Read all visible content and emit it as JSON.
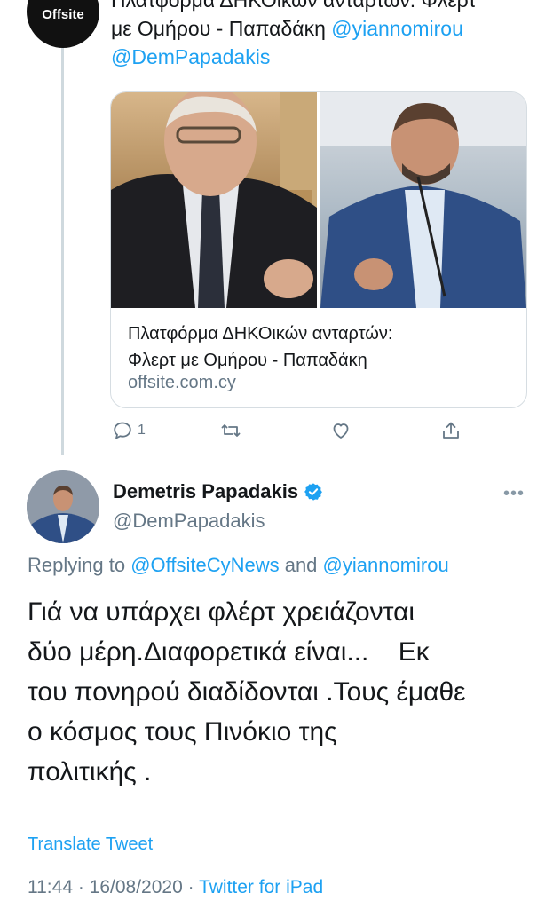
{
  "quoted_tweet": {
    "avatar_text": "Offsite",
    "text_line1": "Πλατφόρμα ΔΗΚΟικών ανταρτών: Φλερτ",
    "text_line2_prefix": "με Ομήρου - Παπαδάκη ",
    "mention1": "@yiannomirou",
    "mention2": "@DemPapadakis",
    "card": {
      "title_line1": "Πλατφόρμα ΔΗΚΟικών ανταρτών:",
      "title_line2": "Φλερτ με Ομήρου - Παπαδάκη",
      "host": "offsite.com.cy"
    },
    "actions": {
      "reply_count": "1",
      "reply_icon": "reply-icon",
      "retweet_icon": "retweet-icon",
      "like_icon": "heart-icon",
      "share_icon": "share-icon"
    }
  },
  "main_tweet": {
    "display_name": "Demetris Papadakis",
    "handle": "@DemPapadakis",
    "verified_icon": "verified-badge-icon",
    "more_label": "•••",
    "replying_prefix": "Replying to ",
    "replying_user1": "@OffsiteCyNews",
    "replying_and": " and ",
    "replying_user2": "@yiannomirou",
    "body_lines": [
      "Γιά να υπάρχει φλέρτ χρειάζονται",
      "δύο μέρη.Διαφορετικά είναι...    Εκ",
      "του πονηρού διαδίδονται .Τους έμαθε",
      "ο κόσμος τους Πινόκιο της",
      "πολιτικής ."
    ],
    "translate_label": "Translate Tweet",
    "time": "11:44",
    "separator": " · ",
    "date": "16/08/2020",
    "source": "Twitter for iPad"
  },
  "colors": {
    "accent": "#1da1f2",
    "secondary_text": "#657786",
    "thread_line": "#cfd9de"
  }
}
